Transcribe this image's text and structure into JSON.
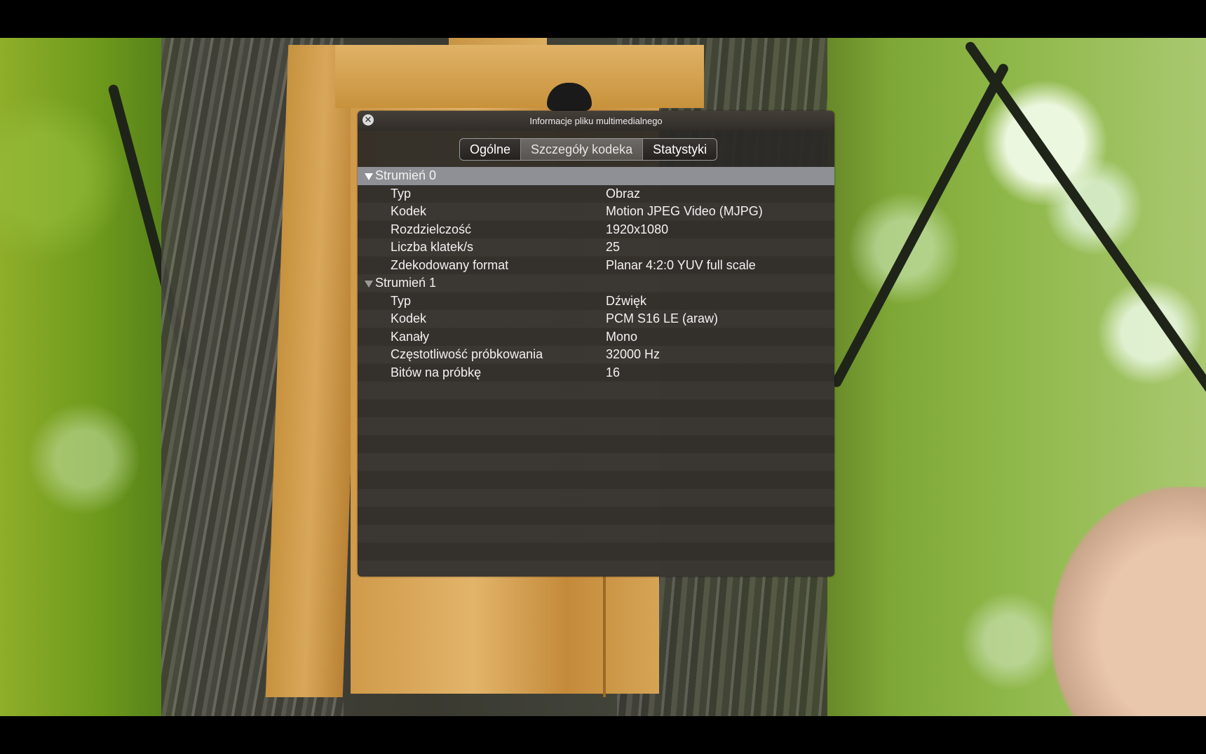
{
  "dialog": {
    "title": "Informacje pliku multimedialnego",
    "tabs": [
      {
        "label": "Ogólne"
      },
      {
        "label": "Szczegóły kodeka",
        "active": true
      },
      {
        "label": "Statystyki"
      }
    ]
  },
  "streams": [
    {
      "label": "Strumień 0",
      "expanded": true,
      "selected": true,
      "properties": [
        {
          "key": "Typ",
          "value": "Obraz"
        },
        {
          "key": "Kodek",
          "value": "Motion JPEG Video (MJPG)"
        },
        {
          "key": "Rozdzielczość",
          "value": "1920x1080"
        },
        {
          "key": "Liczba klatek/s",
          "value": "25"
        },
        {
          "key": "Zdekodowany format",
          "value": "Planar 4:2:0 YUV full scale"
        }
      ]
    },
    {
      "label": "Strumień 1",
      "expanded": true,
      "selected": false,
      "properties": [
        {
          "key": "Typ",
          "value": "Dźwięk"
        },
        {
          "key": "Kodek",
          "value": "PCM S16 LE (araw)"
        },
        {
          "key": "Kanały",
          "value": "Mono"
        },
        {
          "key": "Częstotliwość próbkowania",
          "value": "32000 Hz"
        },
        {
          "key": "Bitów na próbkę",
          "value": "16"
        }
      ]
    }
  ],
  "icons": {
    "close": "close-icon",
    "disclosure": "disclosure-triangle-icon"
  },
  "colors": {
    "selected_row": "#8e9096",
    "panel_bg": "#2c2926"
  }
}
